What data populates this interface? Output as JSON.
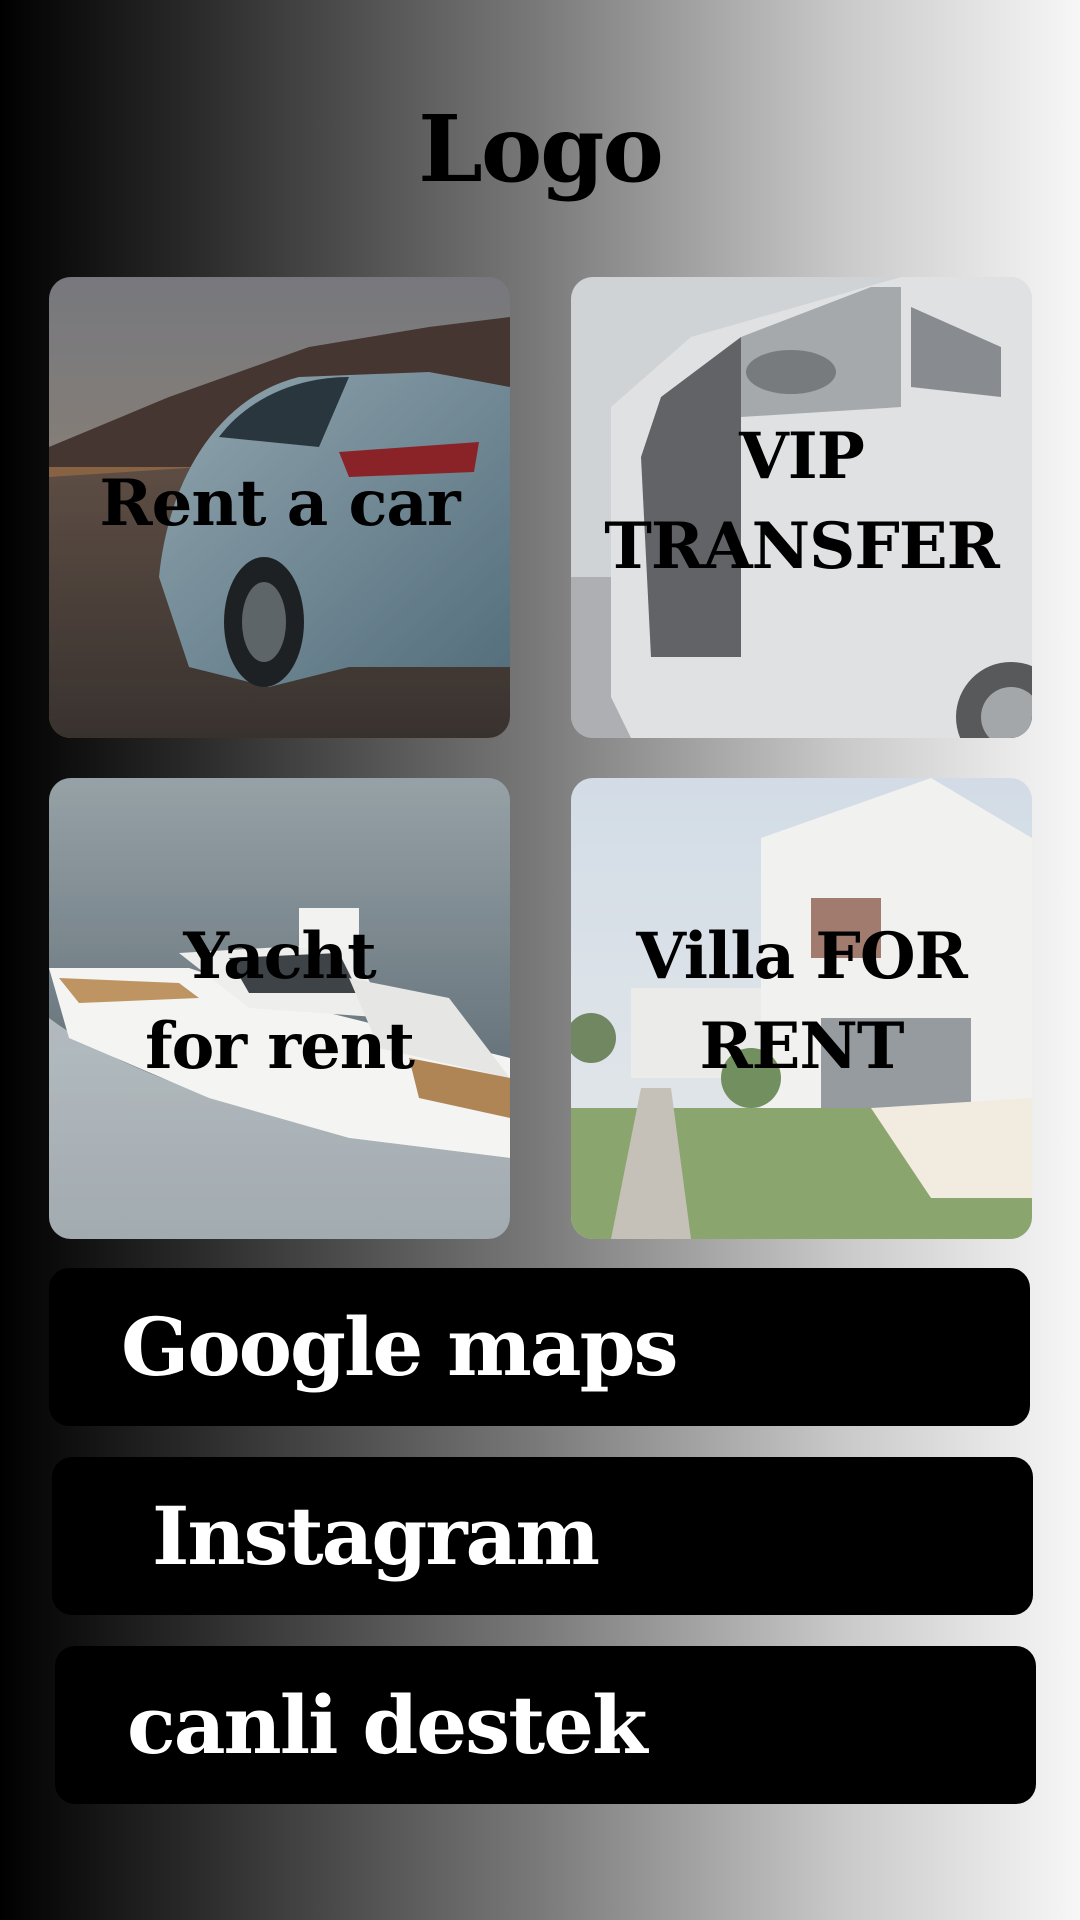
{
  "header": {
    "logo_text": "Logo"
  },
  "tiles": [
    {
      "id": "rent-a-car",
      "lines": [
        "Rent a car"
      ]
    },
    {
      "id": "vip-transfer",
      "lines": [
        "VIP",
        "TRANSFER"
      ]
    },
    {
      "id": "yacht",
      "lines": [
        "Yacht",
        "for rent"
      ]
    },
    {
      "id": "villa",
      "lines": [
        "Villa FOR",
        "RENT"
      ]
    }
  ],
  "buttons": {
    "maps": "Google maps",
    "instagram": "Instagram",
    "chat": "canli destek"
  },
  "colors": {
    "button_bg": "#000000",
    "button_text": "#ffffff",
    "label_text": "#000000"
  }
}
